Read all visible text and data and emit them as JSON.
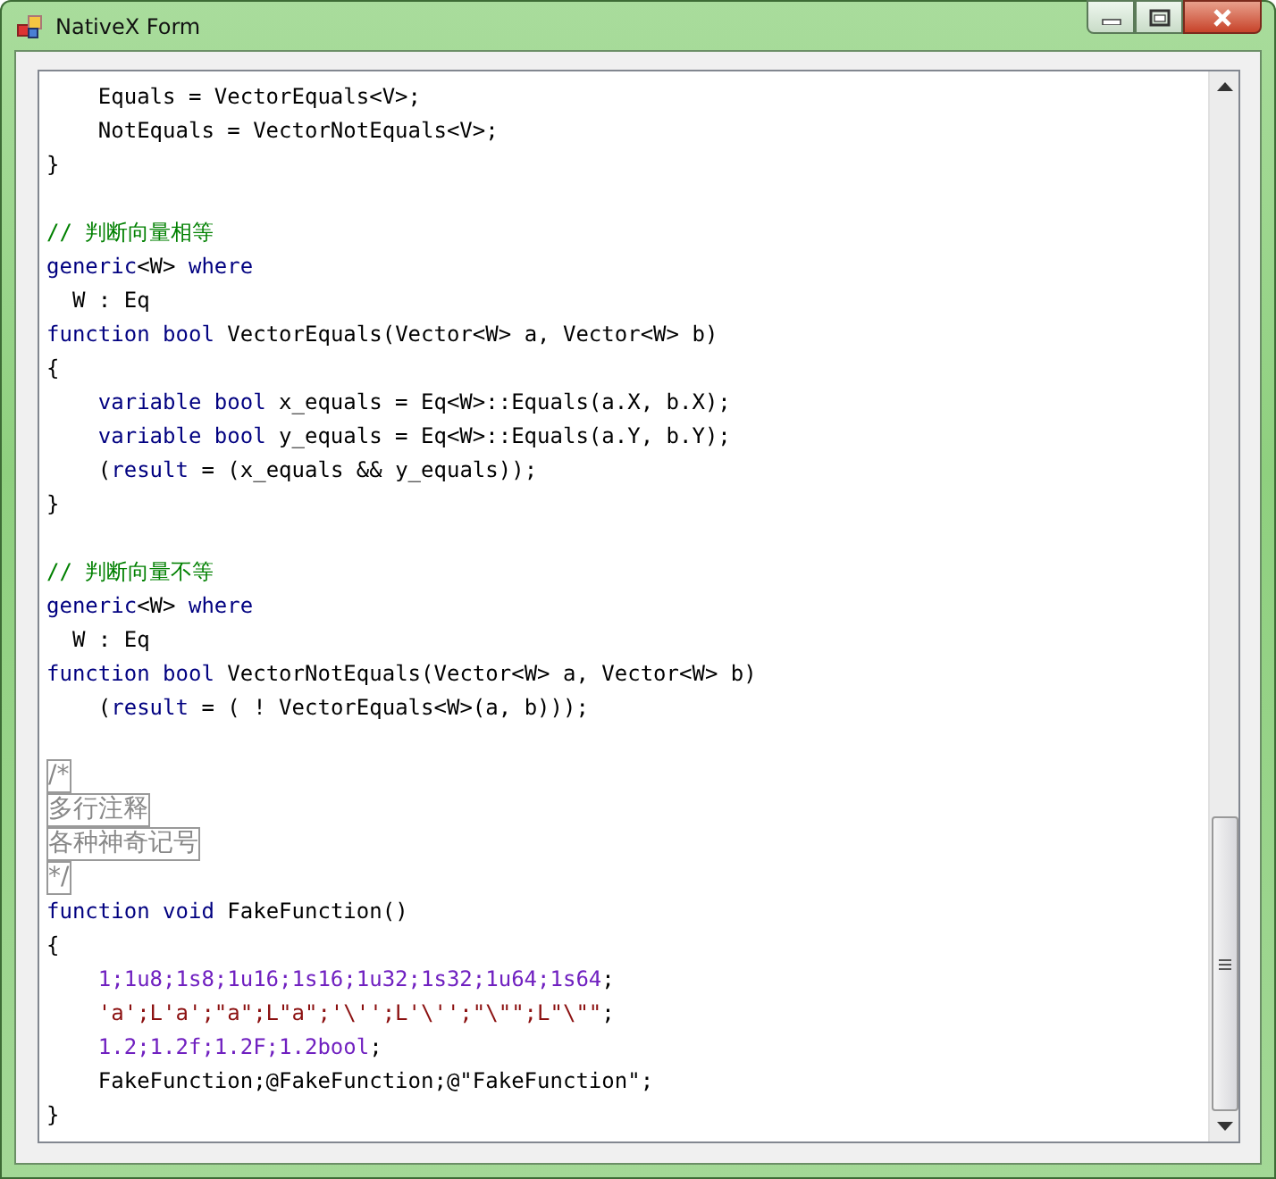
{
  "window": {
    "title": "NativeX Form"
  },
  "code_lines": [
    {
      "kind": "code",
      "indented": true,
      "tokens": [
        {
          "kind": "plain",
          "text": "Equals = VectorEquals<V>;"
        }
      ]
    },
    {
      "kind": "code",
      "indented": true,
      "tokens": [
        {
          "kind": "plain",
          "text": "NotEquals = VectorNotEquals<V>;"
        }
      ]
    },
    {
      "kind": "code",
      "indented": false,
      "tokens": [
        {
          "kind": "plain",
          "text": "}"
        }
      ]
    },
    {
      "kind": "blank"
    },
    {
      "kind": "code",
      "indented": false,
      "tokens": [
        {
          "kind": "comment",
          "text": "// 判断向量相等"
        }
      ]
    },
    {
      "kind": "code",
      "indented": false,
      "tokens": [
        {
          "kind": "keyword",
          "text": "generic"
        },
        {
          "kind": "plain",
          "text": "<W> "
        },
        {
          "kind": "keyword",
          "text": "where"
        }
      ]
    },
    {
      "kind": "code",
      "indented": false,
      "tokens": [
        {
          "kind": "plain",
          "text": "  W : Eq"
        }
      ]
    },
    {
      "kind": "code",
      "indented": false,
      "tokens": [
        {
          "kind": "keyword",
          "text": "function bool"
        },
        {
          "kind": "plain",
          "text": " VectorEquals(Vector<W> a, Vector<W> b)"
        }
      ]
    },
    {
      "kind": "code",
      "indented": false,
      "tokens": [
        {
          "kind": "plain",
          "text": "{"
        }
      ]
    },
    {
      "kind": "code",
      "indented": true,
      "tokens": [
        {
          "kind": "keyword",
          "text": "variable bool"
        },
        {
          "kind": "plain",
          "text": " x_equals = Eq<W>::Equals(a.X, b.X);"
        }
      ]
    },
    {
      "kind": "code",
      "indented": true,
      "tokens": [
        {
          "kind": "keyword",
          "text": "variable bool"
        },
        {
          "kind": "plain",
          "text": " y_equals = Eq<W>::Equals(a.Y, b.Y);"
        }
      ]
    },
    {
      "kind": "code",
      "indented": true,
      "tokens": [
        {
          "kind": "plain",
          "text": "("
        },
        {
          "kind": "keyword",
          "text": "result"
        },
        {
          "kind": "plain",
          "text": " = (x_equals && y_equals));"
        }
      ]
    },
    {
      "kind": "code",
      "indented": false,
      "tokens": [
        {
          "kind": "plain",
          "text": "}"
        }
      ]
    },
    {
      "kind": "blank"
    },
    {
      "kind": "code",
      "indented": false,
      "tokens": [
        {
          "kind": "comment",
          "text": "// 判断向量不等"
        }
      ]
    },
    {
      "kind": "code",
      "indented": false,
      "tokens": [
        {
          "kind": "keyword",
          "text": "generic"
        },
        {
          "kind": "plain",
          "text": "<W> "
        },
        {
          "kind": "keyword",
          "text": "where"
        }
      ]
    },
    {
      "kind": "code",
      "indented": false,
      "tokens": [
        {
          "kind": "plain",
          "text": "  W : Eq"
        }
      ]
    },
    {
      "kind": "code",
      "indented": false,
      "tokens": [
        {
          "kind": "keyword",
          "text": "function bool"
        },
        {
          "kind": "plain",
          "text": " VectorNotEquals(Vector<W> a, Vector<W> b)"
        }
      ]
    },
    {
      "kind": "code",
      "indented": true,
      "tokens": [
        {
          "kind": "plain",
          "text": "("
        },
        {
          "kind": "keyword",
          "text": "result"
        },
        {
          "kind": "plain",
          "text": " = ( ! VectorEquals<W>(a, b)));"
        }
      ]
    },
    {
      "kind": "blank"
    },
    {
      "kind": "code",
      "indented": false,
      "tokens": [
        {
          "kind": "boxed",
          "text": "/*"
        }
      ]
    },
    {
      "kind": "code",
      "indented": false,
      "tokens": [
        {
          "kind": "boxed",
          "text": "多行注释"
        }
      ]
    },
    {
      "kind": "code",
      "indented": false,
      "tokens": [
        {
          "kind": "boxed",
          "text": "各种神奇记号"
        }
      ]
    },
    {
      "kind": "code",
      "indented": false,
      "tokens": [
        {
          "kind": "boxed",
          "text": "*/"
        }
      ]
    },
    {
      "kind": "code",
      "indented": false,
      "tokens": [
        {
          "kind": "keyword",
          "text": "function void"
        },
        {
          "kind": "plain",
          "text": " FakeFunction()"
        }
      ]
    },
    {
      "kind": "code",
      "indented": false,
      "tokens": [
        {
          "kind": "plain",
          "text": "{"
        }
      ]
    },
    {
      "kind": "code",
      "indented": true,
      "tokens": [
        {
          "kind": "number",
          "text": "1;1u8;1s8;1u16;1s16;1u32;1s32;1u64;1s64"
        },
        {
          "kind": "plain",
          "text": ";"
        }
      ]
    },
    {
      "kind": "code",
      "indented": true,
      "tokens": [
        {
          "kind": "string",
          "text": "'a';L'a';\"a\";L\"a\";'\\'';L'\\'';\"\\\"\";L\"\\\"\""
        },
        {
          "kind": "plain",
          "text": ";"
        }
      ]
    },
    {
      "kind": "code",
      "indented": true,
      "tokens": [
        {
          "kind": "number",
          "text": "1.2;1.2f;1.2F;1.2bool"
        },
        {
          "kind": "plain",
          "text": ";"
        }
      ]
    },
    {
      "kind": "code",
      "indented": true,
      "tokens": [
        {
          "kind": "plain",
          "text": "FakeFunction;@FakeFunction;@\"FakeFunction\";"
        }
      ]
    },
    {
      "kind": "code",
      "indented": false,
      "tokens": [
        {
          "kind": "plain",
          "text": "}"
        }
      ]
    }
  ]
}
